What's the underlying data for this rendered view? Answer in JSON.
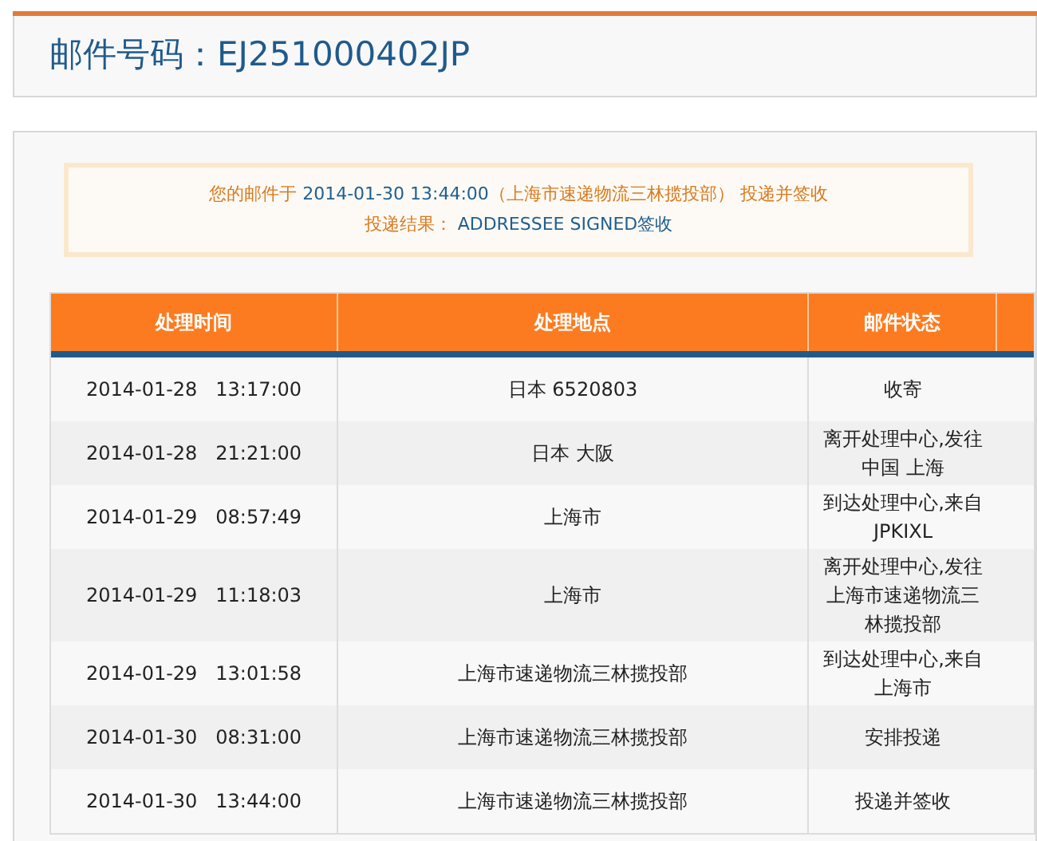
{
  "header": {
    "title": "邮件号码：EJ251000402JP"
  },
  "notice": {
    "lines": [
      [
        {
          "kind": "label",
          "text": "您的邮件于 "
        },
        {
          "kind": "value",
          "text": "2014-01-30 13:44:00"
        },
        {
          "kind": "label",
          "text": "（上海市速递物流三林揽投部） 投递并签收"
        }
      ],
      [
        {
          "kind": "label",
          "text": "投递结果： "
        },
        {
          "kind": "value",
          "text": "ADDRESSEE SIGNED签收"
        }
      ]
    ]
  },
  "table": {
    "columns": [
      "处理时间",
      "处理地点",
      "邮件状态"
    ],
    "rows": [
      {
        "time": "2014-01-28   13:17:00",
        "place": "日本 6520803",
        "status": "收寄"
      },
      {
        "time": "2014-01-28   21:21:00",
        "place": "日本 大阪",
        "status": "离开处理中心,发往中国 上海"
      },
      {
        "time": "2014-01-29   08:57:49",
        "place": "上海市",
        "status": "到达处理中心,来自JPKIXL"
      },
      {
        "time": "2014-01-29   11:18:03",
        "place": "上海市",
        "status": "离开处理中心,发往上海市速递物流三林揽投部"
      },
      {
        "time": "2014-01-29   13:01:58",
        "place": "上海市速递物流三林揽投部",
        "status": "到达处理中心,来自上海市"
      },
      {
        "time": "2014-01-30   08:31:00",
        "place": "上海市速递物流三林揽投部",
        "status": "安排投递"
      },
      {
        "time": "2014-01-30   13:44:00",
        "place": "上海市速递物流三林揽投部",
        "status": "投递并签收"
      }
    ]
  }
}
